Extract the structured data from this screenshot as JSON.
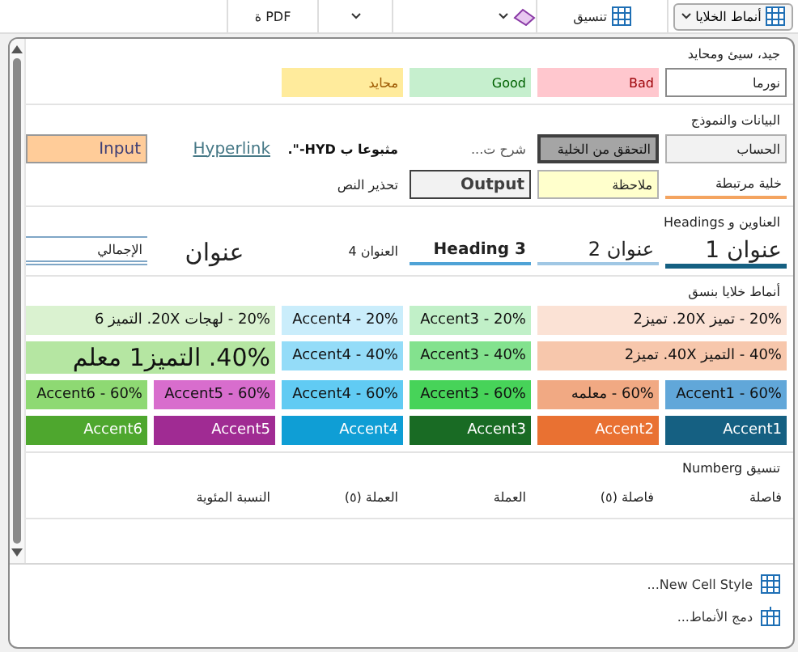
{
  "ribbon": {
    "items": [
      {
        "kind": "styles",
        "label": "أنماط الخلايا"
      },
      {
        "kind": "table",
        "label": "تنسيق"
      },
      {
        "kind": "eraser"
      },
      {
        "kind": "caret"
      },
      {
        "kind": "text",
        "label": "PDF ة"
      }
    ]
  },
  "gallery": {
    "sections": [
      {
        "heading": "جيد، سيئ ومحايد",
        "rows": [
          [
            {
              "label": "نورما",
              "kind": "normal"
            },
            {
              "label": "Bad",
              "kind": "bad"
            },
            {
              "label": "Good",
              "kind": "good"
            },
            {
              "label": "محايد",
              "kind": "neutral"
            }
          ]
        ]
      },
      {
        "heading": "البيانات والنموذج",
        "rows": [
          [
            {
              "label": "الحساب",
              "kind": "calculation"
            },
            {
              "label": "التحقق من الخلية",
              "kind": "check"
            },
            {
              "label": "شرح ت...",
              "kind": "explanatory"
            },
            {
              "label": "مثبوعا ب HYD-\".",
              "kind": "followed"
            },
            {
              "label": "Hyperlink",
              "kind": "hyperlink"
            },
            {
              "label": "Input",
              "kind": "input"
            }
          ],
          [
            {
              "label": "خلية مرتبطة",
              "kind": "linked"
            },
            {
              "label": "ملاحظة",
              "kind": "note"
            },
            {
              "label": "Output",
              "kind": "output"
            },
            {
              "label": "تحذير النص",
              "kind": "warning"
            }
          ]
        ]
      },
      {
        "heading": "العناوين و Headings",
        "rows": [
          [
            {
              "label": "عنوان 1",
              "kind": "h1"
            },
            {
              "label": "عنوان 2",
              "kind": "h2"
            },
            {
              "label": "Heading 3",
              "kind": "h3"
            },
            {
              "label": "العنوان 4",
              "kind": "h4"
            },
            {
              "label": "عنوان",
              "kind": "title"
            },
            {
              "label": "الإجمالي",
              "kind": "total"
            }
          ]
        ]
      },
      {
        "heading": "أنماط خلايا بنسق",
        "rows": [
          [
            {
              "label": "20% - تميز 20X. تميز2",
              "kind": "wide",
              "color": "#fbe2d5"
            },
            {
              "label": "20% - Accent3",
              "kind": "tint",
              "color": "#c1f0c8"
            },
            {
              "label": "20% - Accent4",
              "kind": "tint",
              "color": "#caedfb"
            },
            {
              "label": "20% - لهجات 20X. التميز 6",
              "kind": "wide",
              "color": "#daf2d0"
            }
          ],
          [
            {
              "label": "40% - التميز 40X. تميز2",
              "kind": "wide",
              "color": "#f7c7ac"
            },
            {
              "label": "40% - Accent3",
              "kind": "tint",
              "color": "#83e28e"
            },
            {
              "label": "40% - Accent4",
              "kind": "tint",
              "color": "#94dcf8"
            },
            {
              "label": "40%. التميز1 معلم",
              "kind": "big",
              "color": "#b5e6a2"
            }
          ],
          [
            {
              "label": "60% - Accent1",
              "kind": "tint",
              "color": "#61a7d9"
            },
            {
              "label": "60% - معلمه",
              "kind": "tint",
              "color": "#f1a983"
            },
            {
              "label": "60% - Accent3",
              "kind": "tint",
              "color": "#47d359"
            },
            {
              "label": "60% - Accent4",
              "kind": "tint",
              "color": "#61cbf3"
            },
            {
              "label": "60% - Accent5",
              "kind": "tint",
              "color": "#d86dcd"
            },
            {
              "label": "60% - Accent6",
              "kind": "tint",
              "color": "#8ed973"
            }
          ],
          [
            {
              "label": "Accent1",
              "kind": "solid",
              "color": "#156082"
            },
            {
              "label": "Accent2",
              "kind": "solid",
              "color": "#e97132"
            },
            {
              "label": "Accent3",
              "kind": "solid",
              "color": "#196b24"
            },
            {
              "label": "Accent4",
              "kind": "solid",
              "color": "#0f9ed5"
            },
            {
              "label": "Accent5",
              "kind": "solid",
              "color": "#a02b93"
            },
            {
              "label": "Accent6",
              "kind": "solid",
              "color": "#4ea72e"
            }
          ]
        ]
      },
      {
        "heading": "تنسيق Numberg",
        "rows": [
          [
            {
              "label": "فاصلة",
              "kind": "number"
            },
            {
              "label": "فاصلة (٥)",
              "kind": "number"
            },
            {
              "label": "العملة",
              "kind": "number"
            },
            {
              "label": "العملة (٥)",
              "kind": "number"
            },
            {
              "label": "النسبة المئوية",
              "kind": "number"
            }
          ]
        ]
      }
    ]
  },
  "menu": [
    {
      "label": "New Cell Style...",
      "kind": "new"
    },
    {
      "label": "دمج الأنماط...",
      "kind": "merge"
    }
  ]
}
